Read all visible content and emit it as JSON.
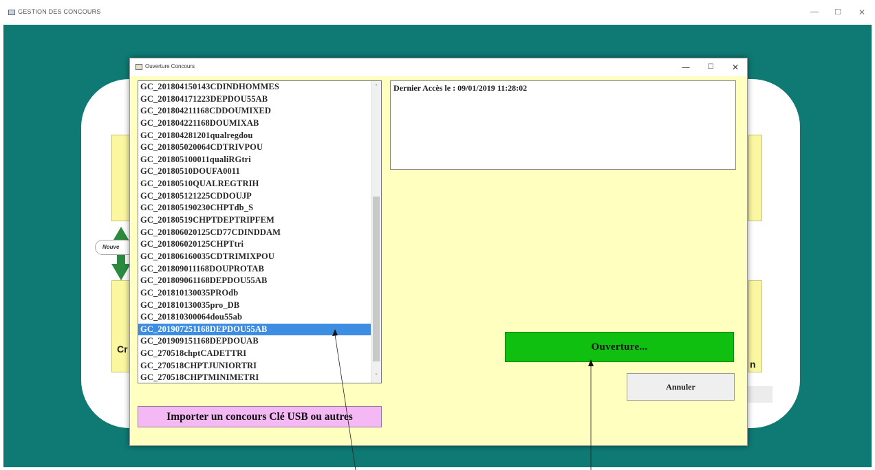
{
  "main_window": {
    "title": "GESTION DES CONCOURS",
    "controls": {
      "minimize": "—",
      "maximize": "☐",
      "close": "✕"
    }
  },
  "background": {
    "nouveau_fragment": "Nouve",
    "left_fragment": "Cr",
    "right_fragment": "n",
    "colors": {
      "teal": "#0e7a73",
      "yellow": "#fbf7a0",
      "green_arrow": "#2b8a3e"
    }
  },
  "dialog": {
    "title": "Ouverture Concours",
    "controls": {
      "minimize": "—",
      "maximize": "☐",
      "close": "✕"
    },
    "background": "#ffffc0",
    "concours_list": [
      "GC_201804150143CDINDHOMMES",
      "GC_201804171223DEPDOU55AB",
      "GC_201804211168CDDOUMIXED",
      "GC_201804221168DOUMIXAB",
      "GC_201804281201qualregdou",
      "GC_201805020064CDTRIVPOU",
      "GC_201805100011qualiRGtri",
      "GC_20180510DOUFA0011",
      "GC_20180510QUALREGTRIH",
      "GC_201805121225CDDOUJP",
      "GC_201805190230CHPTdb_S",
      "GC_20180519CHPTDEPTRIPFEM",
      "GC_201806020125CD77CDINDDAM",
      "GC_201806020125CHPTtri",
      "GC_201806160035CDTRIMIXPOU",
      "GC_201809011168DOUPROTAB",
      "GC_201809061168DEPDOU55AB",
      "GC_201810130035PROdb",
      "GC_201810130035pro_DB",
      "GC_201810300064dou55ab",
      "GC_201907251168DEPDOU55AB",
      "GC_201909151168DEPDOUAB",
      "GC_270518chptCADETTRI",
      "GC_270518CHPTJUNIORTRI",
      "GC_270518CHPTMINIMETRI"
    ],
    "selected_index": 20,
    "selected_color": "#3d8ee3",
    "scroll_up": "˄",
    "scroll_down": "˅",
    "info_text": "Dernier Accès le : 09/01/2019 11:28:02",
    "open_button": "Ouverture...",
    "open_button_color": "#10c010",
    "cancel_button": "Annuler",
    "import_button": "Importer un concours Clé USB ou autres",
    "import_button_color": "#f4b8f4"
  }
}
